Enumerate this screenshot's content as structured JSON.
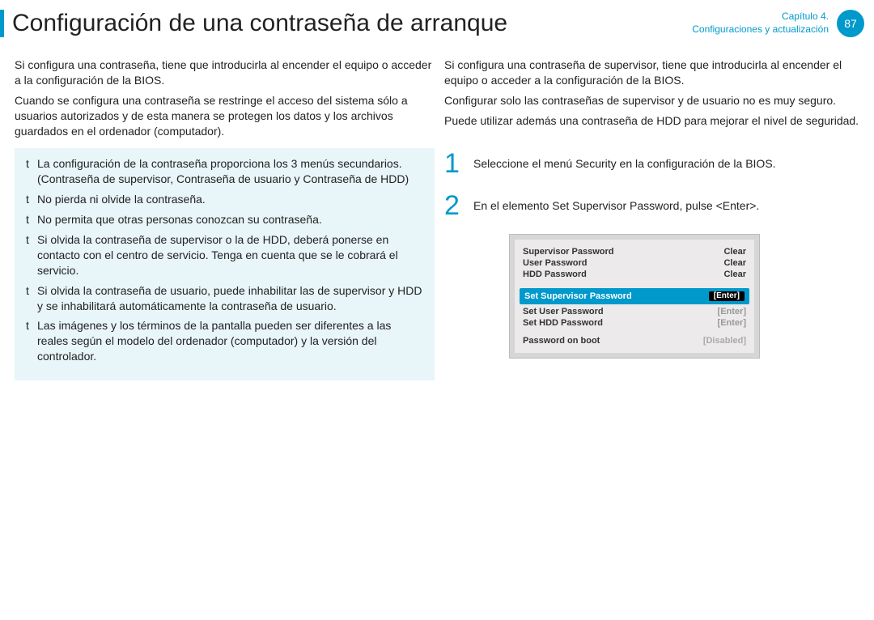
{
  "header": {
    "title": "Conﬁguración de una contraseña de arranque",
    "chapter_line1": "Capítulo 4.",
    "chapter_line2": "Conﬁguraciones y actualización",
    "page_number": "87"
  },
  "left_col": {
    "p1": "Si conﬁgura una contraseña, tiene que introducirla al encender el equipo o acceder a la conﬁguración de la BIOS.",
    "p2": "Cuando se conﬁgura una contraseña se restringe el acceso del sistema sólo a usuarios autorizados y de esta manera se protegen los datos y los archivos guardados en el ordenador (computador).",
    "notes": [
      "La conﬁguración de la contraseña proporciona los 3 menús secundarios. (Contraseña de supervisor, Contraseña de usuario y Contraseña de HDD)",
      "No pierda ni olvide la contraseña.",
      "No permita que otras personas conozcan su contraseña.",
      "Si olvida la contraseña de supervisor o la de HDD, deberá ponerse en contacto con el centro de servicio. Tenga en cuenta que se le cobrará el servicio.",
      "Si olvida la contraseña de usuario, puede inhabilitar las de supervisor y HDD y se inhabilitará automáticamente la contraseña de usuario.",
      "Las imágenes y los términos de la pantalla pueden ser diferentes a las reales según el modelo del ordenador (computador) y la versión del controlador."
    ]
  },
  "right_col": {
    "p1": "Si conﬁgura una contraseña de supervisor, tiene que introducirla al encender el equipo o acceder a la conﬁguración de la BIOS.",
    "p2": "Conﬁgurar solo las contraseñas de supervisor y de usuario no es muy seguro.",
    "p3": "Puede utilizar además una contraseña de HDD para mejorar el nivel de seguridad.",
    "steps": {
      "s1_num": "1",
      "s1_text": "Seleccione el menú Security en la conﬁguración de la BIOS.",
      "s2_num": "2",
      "s2_text": "En el elemento Set Supervisor Password, pulse <Enter>."
    }
  },
  "bios": {
    "rows_top": [
      {
        "label": "Supervisor Password",
        "value": "Clear"
      },
      {
        "label": "User Password",
        "value": "Clear"
      },
      {
        "label": "HDD Password",
        "value": "Clear"
      }
    ],
    "highlight": {
      "label": "Set Supervisor Password",
      "value": "[Enter]"
    },
    "rows_mid": [
      {
        "label": "Set User Password",
        "value": "[Enter]"
      },
      {
        "label": "Set HDD Password",
        "value": "[Enter]"
      }
    ],
    "rows_bottom": [
      {
        "label": "Password on boot",
        "value": "[Disabled]"
      }
    ]
  }
}
